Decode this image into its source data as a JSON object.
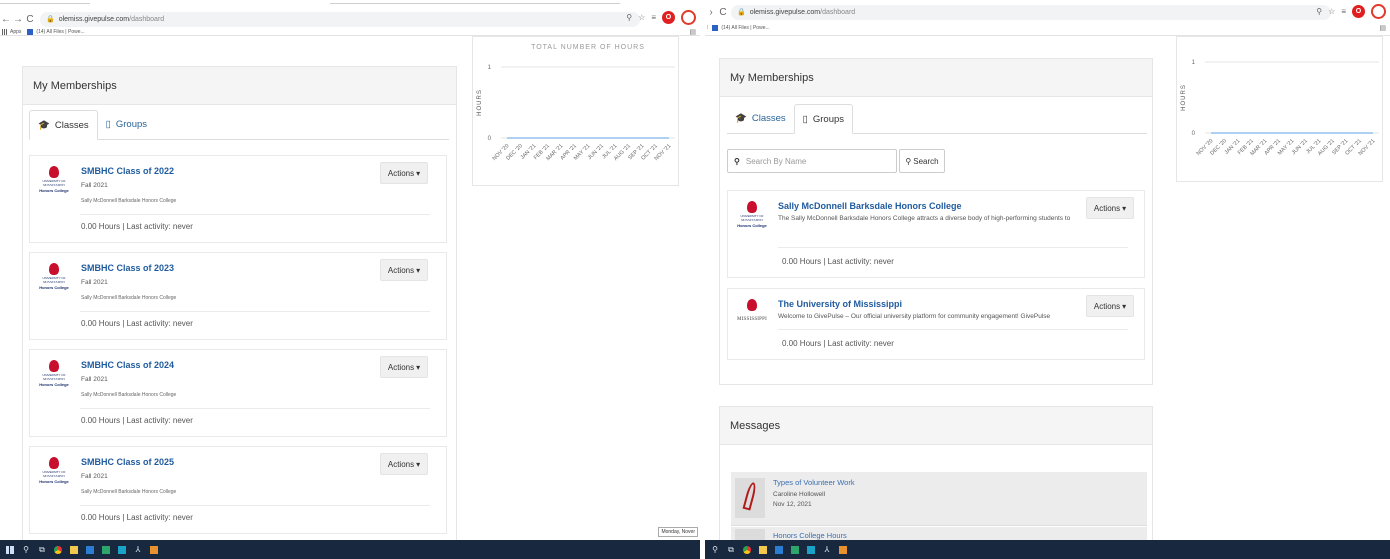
{
  "left": {
    "browser": {
      "url_host": "olemiss.givepulse.com",
      "url_path": "/dashboard",
      "apps_label": "Apps",
      "bookmark_label": "(14) All Files | Powe..."
    },
    "chart": {
      "title": "TOTAL NUMBER OF HOURS",
      "ylabel": "HOURS"
    },
    "memberships": {
      "title": "My Memberships",
      "tabs": [
        {
          "label": "Classes",
          "icon": "graduation-cap-icon",
          "active": true
        },
        {
          "label": "Groups",
          "icon": "building-icon",
          "active": false
        }
      ],
      "cards": [
        {
          "title": "SMBHC Class of 2022",
          "term": "Fall 2021",
          "org": "Sally McDonnell Barksdale Honors College",
          "stats": "0.00 Hours | Last activity: never",
          "actions": "Actions"
        },
        {
          "title": "SMBHC Class of 2023",
          "term": "Fall 2021",
          "org": "Sally McDonnell Barksdale Honors College",
          "stats": "0.00 Hours | Last activity: never",
          "actions": "Actions"
        },
        {
          "title": "SMBHC Class of 2024",
          "term": "Fall 2021",
          "org": "Sally McDonnell Barksdale Honors College",
          "stats": "0.00 Hours | Last activity: never",
          "actions": "Actions"
        },
        {
          "title": "SMBHC Class of 2025",
          "term": "Fall 2021",
          "org": "Sally McDonnell Barksdale Honors College",
          "stats": "0.00 Hours | Last activity: never",
          "actions": "Actions"
        }
      ],
      "logo_text": {
        "line1": "UNIVERSITY OF",
        "line2": "MISSISSIPPI",
        "line3": "Honors College"
      }
    },
    "tooltip": "Monday, Nover"
  },
  "right": {
    "browser": {
      "url_host": "olemiss.givepulse.com",
      "url_path": "/dashboard",
      "bookmark_label": "(14) All Files | Powe..."
    },
    "chart": {
      "ylabel": "HOURS"
    },
    "memberships": {
      "title": "My Memberships",
      "tabs": [
        {
          "label": "Classes",
          "icon": "graduation-cap-icon",
          "active": false
        },
        {
          "label": "Groups",
          "icon": "building-icon",
          "active": true
        }
      ],
      "search_placeholder": "Search By Name",
      "search_button": "Search",
      "cards": [
        {
          "title": "Sally McDonnell Barksdale Honors College",
          "desc": "The Sally McDonnell Barksdale Honors College attracts a diverse body of high-performing students to",
          "stats": "0.00 Hours | Last activity: never",
          "actions": "Actions"
        },
        {
          "title": "The University of Mississippi",
          "desc": "Welcome to GivePulse – Our official university platform for community engagement! GivePulse",
          "stats": "0.00 Hours | Last activity: never",
          "actions": "Actions"
        }
      ],
      "logo_text": {
        "line1": "UNIVERSITY OF",
        "line2": "MISSISSIPPI",
        "line3": "Honors College"
      },
      "uni_logo_text": "MISSISSIPPI"
    },
    "messages": {
      "title": "Messages",
      "items": [
        {
          "title": "Types of Volunteer Work",
          "from": "Caroline Hollowell",
          "date": "Nov 12, 2021"
        },
        {
          "title": "Honors College Hours",
          "from": "",
          "date": ""
        }
      ]
    }
  },
  "chart_data": [
    {
      "type": "line",
      "title": "TOTAL NUMBER OF HOURS",
      "ylabel": "HOURS",
      "x": [
        "NOV '20",
        "DEC '20",
        "JAN '21",
        "FEB '21",
        "MAR '21",
        "APR '21",
        "MAY '21",
        "JUN '21",
        "JUL '21",
        "AUG '21",
        "SEP '21",
        "OCT '21",
        "NOV '21"
      ],
      "series": [
        {
          "values": [
            0,
            0,
            0,
            0,
            0,
            0,
            0,
            0,
            0,
            0,
            0,
            0,
            0
          ]
        }
      ],
      "ylim": [
        0,
        1
      ],
      "yticks": [
        "0",
        "1"
      ],
      "grid": true,
      "color": "#7cb5ec"
    },
    {
      "type": "line",
      "ylabel": "HOURS",
      "x": [
        "NOV '20",
        "DEC '20",
        "JAN '21",
        "FEB '21",
        "MAR '21",
        "APR '21",
        "MAY '21",
        "JUN '21",
        "JUL '21",
        "AUG '21",
        "SEP '21",
        "OCT '21",
        "NOV '21"
      ],
      "series": [
        {
          "values": [
            0,
            0,
            0,
            0,
            0,
            0,
            0,
            0,
            0,
            0,
            0,
            0,
            0
          ]
        }
      ],
      "ylim": [
        0,
        1
      ],
      "yticks": [
        "0",
        "1"
      ],
      "grid": true,
      "color": "#7cb5ec"
    }
  ]
}
